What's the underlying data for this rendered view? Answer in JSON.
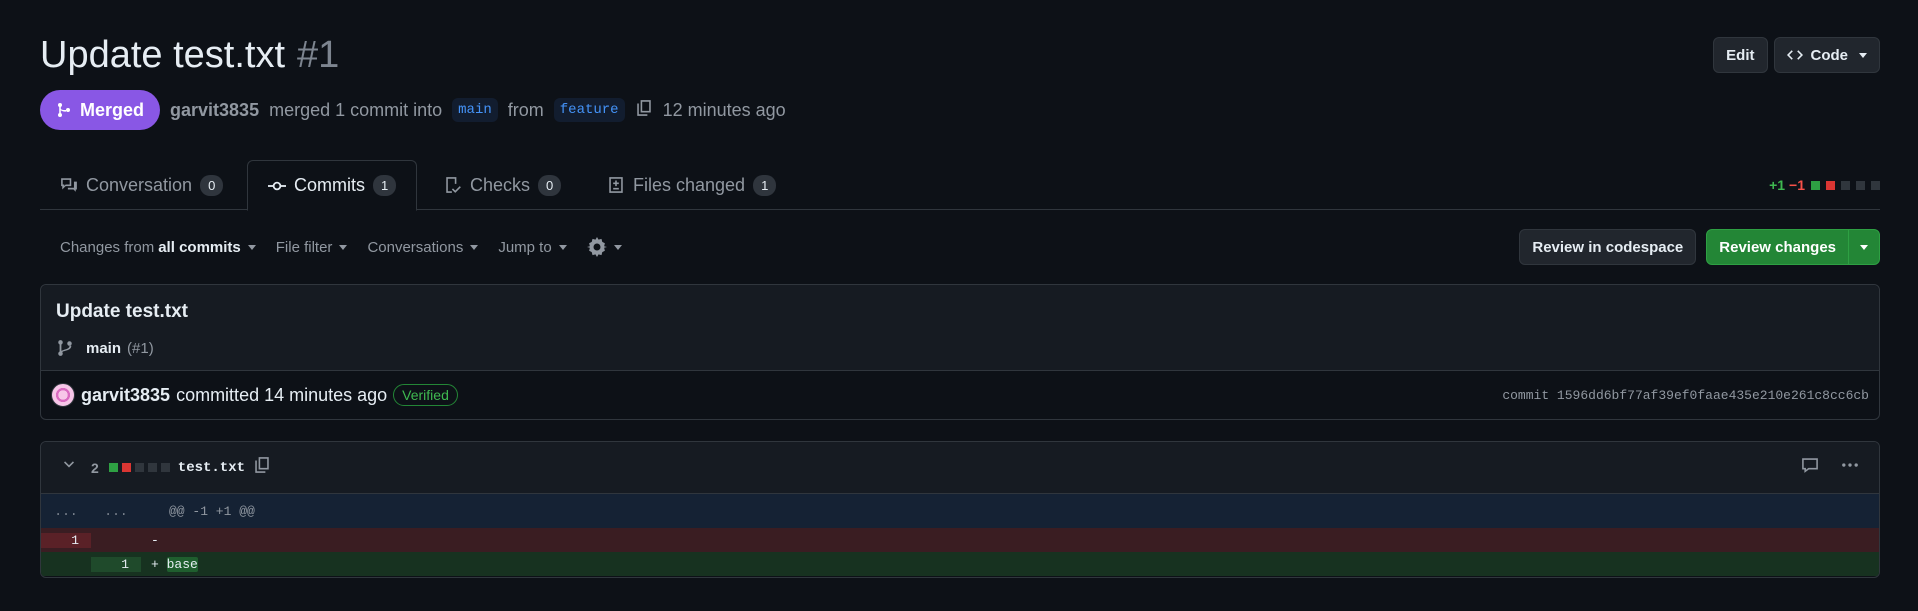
{
  "pr": {
    "title": "Update test.txt",
    "number": "#1",
    "state": "Merged",
    "author": "garvit3835",
    "merge_text": "merged 1 commit into",
    "base_branch": "main",
    "from_text": "from",
    "head_branch": "feature",
    "time_ago": "12 minutes ago"
  },
  "header_actions": {
    "edit": "Edit",
    "code": "Code"
  },
  "tabs": [
    {
      "label": "Conversation",
      "count": "0",
      "icon": "comment-discussion-icon"
    },
    {
      "label": "Commits",
      "count": "1",
      "icon": "git-commit-icon",
      "active": true
    },
    {
      "label": "Checks",
      "count": "0",
      "icon": "checklist-icon"
    },
    {
      "label": "Files changed",
      "count": "1",
      "icon": "file-diff-icon"
    }
  ],
  "diffstat": {
    "additions": "+1",
    "deletions": "−1"
  },
  "toolbar": {
    "changes_prefix": "Changes from",
    "changes_value": "all commits",
    "file_filter": "File filter",
    "conversations": "Conversations",
    "jump_to": "Jump to"
  },
  "review": {
    "codespace": "Review in codespace",
    "changes": "Review changes"
  },
  "commit": {
    "title": "Update test.txt",
    "branch": "main",
    "ref": "(#1)",
    "author": "garvit3835",
    "verb": "committed 14 minutes ago",
    "verified": "Verified",
    "sha": "commit 1596dd6bf77af39ef0faae435e210e261c8cc6cb"
  },
  "diff": {
    "changes": "2",
    "filename": "test.txt",
    "hunk_old": "...",
    "hunk_new": "...",
    "hunk": "@@ -1 +1 @@",
    "del_num": "1",
    "del_code": "-",
    "add_num": "1",
    "add_sign": "+ ",
    "add_code": "base"
  },
  "colors": {
    "merged": "#8957e5",
    "green": "#238636",
    "link": "#4493f8"
  }
}
